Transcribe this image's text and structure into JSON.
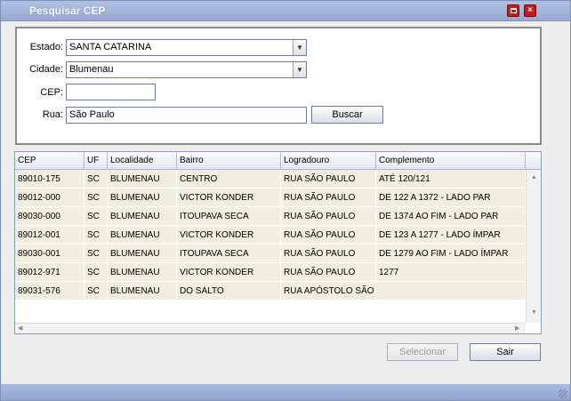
{
  "window": {
    "title": "Pesquisar CEP"
  },
  "form": {
    "estado_label": "Estado:",
    "estado_value": "SANTA CATARINA",
    "cidade_label": "Cidade:",
    "cidade_value": "Blumenau",
    "cep_label": "CEP:",
    "cep_value": "",
    "rua_label": "Rua:",
    "rua_value": "São Paulo",
    "buscar_label": "Buscar"
  },
  "grid": {
    "columns": [
      "CEP",
      "UF",
      "Localidade",
      "Bairro",
      "Logradouro",
      "Complemento"
    ],
    "rows": [
      [
        "89010-175",
        "SC",
        "BLUMENAU",
        "CENTRO",
        "RUA SÃO PAULO",
        "ATÉ 120/121"
      ],
      [
        "89012-000",
        "SC",
        "BLUMENAU",
        "VICTOR KONDER",
        "RUA SÃO PAULO",
        "DE 122 A 1372 - LADO PAR"
      ],
      [
        "89030-000",
        "SC",
        "BLUMENAU",
        "ITOUPAVA SECA",
        "RUA SÃO PAULO",
        "DE 1374 AO FIM - LADO PAR"
      ],
      [
        "89012-001",
        "SC",
        "BLUMENAU",
        "VICTOR KONDER",
        "RUA SÃO PAULO",
        "DE 123 A 1277 - LADO ÍMPAR"
      ],
      [
        "89030-001",
        "SC",
        "BLUMENAU",
        "ITOUPAVA SECA",
        "RUA SÃO PAULO",
        "DE 1279 AO FIM - LADO ÍMPAR"
      ],
      [
        "89012-971",
        "SC",
        "BLUMENAU",
        "VICTOR KONDER",
        "RUA SÃO PAULO",
        "1277"
      ],
      [
        "89031-576",
        "SC",
        "BLUMENAU",
        "DO SALTO",
        "RUA APÓSTOLO SÃO",
        ""
      ]
    ]
  },
  "footer": {
    "selecionar_label": "Selecionar",
    "sair_label": "Sair"
  },
  "icons": {
    "close": "close-icon",
    "maximize": "maximize-icon",
    "dropdown": "chevron-down-icon"
  },
  "colors": {
    "titlebar": "#95a8d2",
    "close_button": "#c8181a",
    "row_bg": "#efeedf"
  }
}
